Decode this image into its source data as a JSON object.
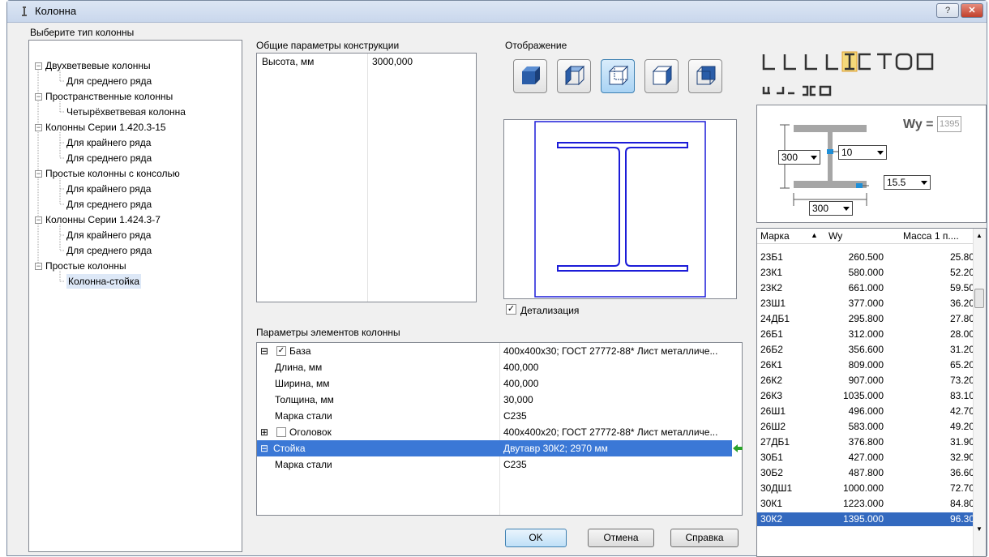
{
  "window": {
    "title": "Колонна",
    "help_label": "?",
    "close_label": "✕"
  },
  "tree": {
    "label": "Выберите тип колонны",
    "items": [
      {
        "label": "Двухветвевые колонны",
        "level": 0
      },
      {
        "label": "Для среднего ряда",
        "level": 1
      },
      {
        "label": "Пространственные колонны",
        "level": 0
      },
      {
        "label": "Четырёхветвевая колонна",
        "level": 1
      },
      {
        "label": "Колонны Серии 1.420.3-15",
        "level": 0
      },
      {
        "label": "Для крайнего ряда",
        "level": 1
      },
      {
        "label": "Для среднего ряда",
        "level": 1
      },
      {
        "label": "Простые колонны с консолью",
        "level": 0
      },
      {
        "label": "Для крайнего ряда",
        "level": 1
      },
      {
        "label": "Для среднего ряда",
        "level": 1
      },
      {
        "label": "Колонны Серии 1.424.3-7",
        "level": 0
      },
      {
        "label": "Для крайнего ряда",
        "level": 1
      },
      {
        "label": "Для среднего ряда",
        "level": 1
      },
      {
        "label": "Простые колонны",
        "level": 0
      },
      {
        "label": "Колонна-стойка",
        "level": 1
      }
    ]
  },
  "general": {
    "label": "Общие параметры конструкции",
    "height_name": "Высота, мм",
    "height_value": "3000,000"
  },
  "display": {
    "label": "Отображение",
    "detail_label": "Детализация",
    "detail_checked": true
  },
  "elements": {
    "label": "Параметры элементов колонны",
    "rows": [
      {
        "name": "База",
        "value": "400x400x30; ГОСТ 27772-88* Лист металличе...",
        "toggle": "⊟",
        "checkbox": true
      },
      {
        "name": "Длина, мм",
        "value": "400,000"
      },
      {
        "name": "Ширина, мм",
        "value": "400,000"
      },
      {
        "name": "Толщина, мм",
        "value": "30,000"
      },
      {
        "name": "Марка стали",
        "value": "С235"
      },
      {
        "name": "Оголовок",
        "value": "400x400x20; ГОСТ 27772-88* Лист металличе...",
        "toggle": "⊞",
        "checkbox": false
      },
      {
        "name": "Стойка",
        "value": "Двутавр 30К2; 2970 мм",
        "toggle": "⊟"
      },
      {
        "name": "Марка стали",
        "value": "С235"
      }
    ]
  },
  "section": {
    "wy_label": "Wy =",
    "wy_value": "1395",
    "h": "300",
    "tw": "10",
    "tf": "15.5",
    "b": "300"
  },
  "profile_shapes": [
    "L",
    "L",
    "L",
    "L",
    "I",
    "E",
    "T",
    "O",
    "▭"
  ],
  "grid": {
    "headers": [
      "Марка",
      "Wy",
      "Масса 1 п...."
    ],
    "rows": [
      [
        "23Б1",
        "260.500",
        "25.80"
      ],
      [
        "23К1",
        "580.000",
        "52.20"
      ],
      [
        "23К2",
        "661.000",
        "59.50"
      ],
      [
        "23Ш1",
        "377.000",
        "36.20"
      ],
      [
        "24ДБ1",
        "295.800",
        "27.80"
      ],
      [
        "26Б1",
        "312.000",
        "28.00"
      ],
      [
        "26Б2",
        "356.600",
        "31.20"
      ],
      [
        "26К1",
        "809.000",
        "65.20"
      ],
      [
        "26К2",
        "907.000",
        "73.20"
      ],
      [
        "26К3",
        "1035.000",
        "83.10"
      ],
      [
        "26Ш1",
        "496.000",
        "42.70"
      ],
      [
        "26Ш2",
        "583.000",
        "49.20"
      ],
      [
        "27ДБ1",
        "376.800",
        "31.90"
      ],
      [
        "30Б1",
        "427.000",
        "32.90"
      ],
      [
        "30Б2",
        "487.800",
        "36.60"
      ],
      [
        "30ДШ1",
        "1000.000",
        "72.70"
      ],
      [
        "30К1",
        "1223.000",
        "84.80"
      ],
      [
        "30К2",
        "1395.000",
        "96.30"
      ]
    ]
  },
  "buttons": {
    "ok": "OK",
    "cancel": "Отмена",
    "help": "Справка"
  },
  "colors": {
    "selection": "#3b78d6",
    "ibeam": "#1c1cd8",
    "accent_green": "#2aa12a"
  }
}
